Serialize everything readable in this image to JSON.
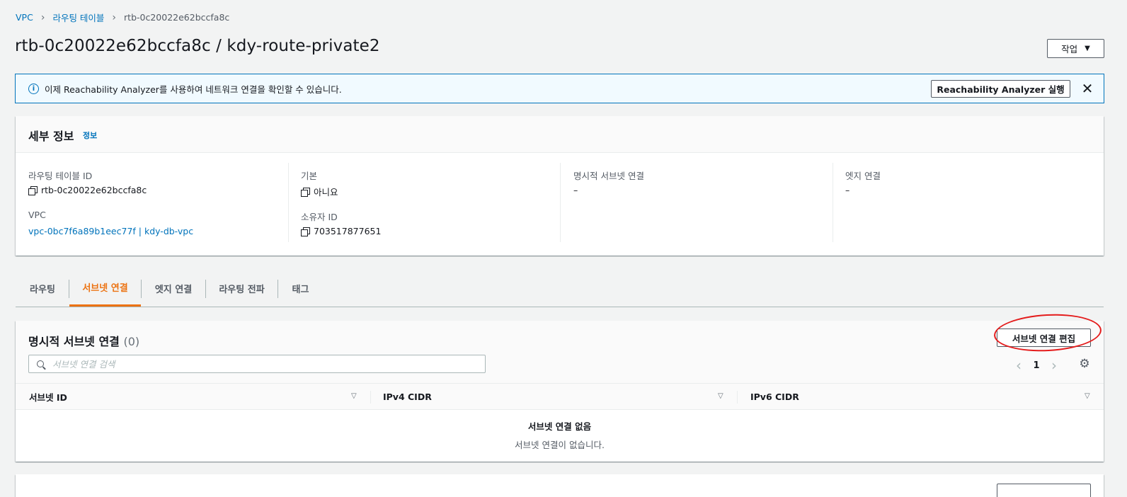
{
  "breadcrumb": {
    "vpc": "VPC",
    "route_tables": "라우팅 테이블",
    "current": "rtb-0c20022e62bccfa8c",
    "separator": "›"
  },
  "page": {
    "title": "rtb-0c20022e62bccfa8c / kdy-route-private2",
    "actions_label": "작업",
    "actions_caret": "▼"
  },
  "flash": {
    "message": "이제 Reachability Analyzer를 사용하여 네트워크 연결을 확인할 수 있습니다.",
    "button_label": "Reachability Analyzer 실행",
    "info_glyph": "i",
    "close_glyph": "✕"
  },
  "details": {
    "title": "세부 정보",
    "info_link": "정보",
    "route_table_id_label": "라우팅 테이블 ID",
    "route_table_id": "rtb-0c20022e62bccfa8c",
    "vpc_label": "VPC",
    "vpc_value": "vpc-0bc7f6a89b1eec77f | kdy-db-vpc",
    "main_label": "기본",
    "main_value": "아니요",
    "owner_label": "소유자 ID",
    "owner_value": "703517877651",
    "explicit_label": "명시적 서브넷 연결",
    "explicit_value": "–",
    "edge_label": "엣지 연결",
    "edge_value": "–"
  },
  "tabs": [
    {
      "label": "라우팅",
      "active": false
    },
    {
      "label": "서브넷 연결",
      "active": true
    },
    {
      "label": "엣지 연결",
      "active": false
    },
    {
      "label": "라우팅 전파",
      "active": false
    },
    {
      "label": "태그",
      "active": false
    }
  ],
  "subnet_assoc": {
    "title": "명시적 서브넷 연결",
    "count": "(0)",
    "edit_button": "서브넷 연결 편집",
    "search_placeholder": "서브넷 연결 검색",
    "page_number": "1",
    "prev_glyph": "‹",
    "next_glyph": "›",
    "settings_glyph": "⚙",
    "sort_glyph": "▽",
    "columns": [
      "서브넷 ID",
      "IPv4 CIDR",
      "IPv6 CIDR"
    ],
    "empty_title": "서브넷 연결 없음",
    "empty_subtitle": "서브넷 연결이 없습니다."
  },
  "colors": {
    "accent": "#ec7211",
    "link": "#0073bb",
    "annotation": "#e41c1c"
  },
  "icons": [
    "info-icon",
    "close-icon",
    "copy-icon",
    "search-icon",
    "chevron-left-icon",
    "chevron-right-icon",
    "gear-icon",
    "sort-icon",
    "caret-down-icon"
  ]
}
